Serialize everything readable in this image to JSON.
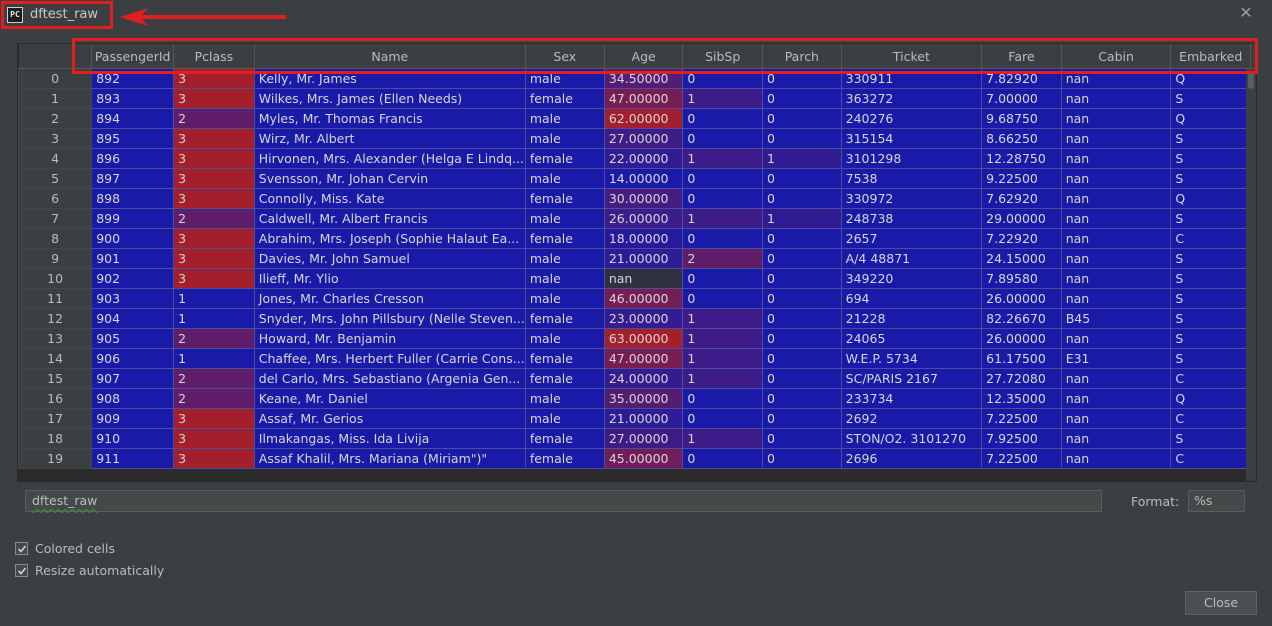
{
  "window": {
    "title": "dftest_raw",
    "icon": "pycharm-icon",
    "icon_text": "PC"
  },
  "table": {
    "columns": [
      "PassengerId",
      "Pclass",
      "Name",
      "Sex",
      "Age",
      "SibSp",
      "Parch",
      "Ticket",
      "Fare",
      "Cabin",
      "Embarked"
    ],
    "rows": [
      {
        "idx": "0",
        "cells": [
          "892",
          "3",
          "Kelly, Mr. James",
          "male",
          "34.50000",
          "0",
          "0",
          "330911",
          "7.82920",
          "nan",
          "Q"
        ]
      },
      {
        "idx": "1",
        "cells": [
          "893",
          "3",
          "Wilkes, Mrs. James (Ellen Needs)",
          "female",
          "47.00000",
          "1",
          "0",
          "363272",
          "7.00000",
          "nan",
          "S"
        ]
      },
      {
        "idx": "2",
        "cells": [
          "894",
          "2",
          "Myles, Mr. Thomas Francis",
          "male",
          "62.00000",
          "0",
          "0",
          "240276",
          "9.68750",
          "nan",
          "Q"
        ]
      },
      {
        "idx": "3",
        "cells": [
          "895",
          "3",
          "Wirz, Mr. Albert",
          "male",
          "27.00000",
          "0",
          "0",
          "315154",
          "8.66250",
          "nan",
          "S"
        ]
      },
      {
        "idx": "4",
        "cells": [
          "896",
          "3",
          "Hirvonen, Mrs. Alexander (Helga E Lindq...",
          "female",
          "22.00000",
          "1",
          "1",
          "3101298",
          "12.28750",
          "nan",
          "S"
        ]
      },
      {
        "idx": "5",
        "cells": [
          "897",
          "3",
          "Svensson, Mr. Johan Cervin",
          "male",
          "14.00000",
          "0",
          "0",
          "7538",
          "9.22500",
          "nan",
          "S"
        ]
      },
      {
        "idx": "6",
        "cells": [
          "898",
          "3",
          "Connolly, Miss. Kate",
          "female",
          "30.00000",
          "0",
          "0",
          "330972",
          "7.62920",
          "nan",
          "Q"
        ]
      },
      {
        "idx": "7",
        "cells": [
          "899",
          "2",
          "Caldwell, Mr. Albert Francis",
          "male",
          "26.00000",
          "1",
          "1",
          "248738",
          "29.00000",
          "nan",
          "S"
        ]
      },
      {
        "idx": "8",
        "cells": [
          "900",
          "3",
          "Abrahim, Mrs. Joseph (Sophie Halaut Ea...",
          "female",
          "18.00000",
          "0",
          "0",
          "2657",
          "7.22920",
          "nan",
          "C"
        ]
      },
      {
        "idx": "9",
        "cells": [
          "901",
          "3",
          "Davies, Mr. John Samuel",
          "male",
          "21.00000",
          "2",
          "0",
          "A/4 48871",
          "24.15000",
          "nan",
          "S"
        ]
      },
      {
        "idx": "10",
        "cells": [
          "902",
          "3",
          "Ilieff, Mr. Ylio",
          "male",
          "nan",
          "0",
          "0",
          "349220",
          "7.89580",
          "nan",
          "S"
        ]
      },
      {
        "idx": "11",
        "cells": [
          "903",
          "1",
          "Jones, Mr. Charles Cresson",
          "male",
          "46.00000",
          "0",
          "0",
          "694",
          "26.00000",
          "nan",
          "S"
        ]
      },
      {
        "idx": "12",
        "cells": [
          "904",
          "1",
          "Snyder, Mrs. John Pillsbury (Nelle Steven...",
          "female",
          "23.00000",
          "1",
          "0",
          "21228",
          "82.26670",
          "B45",
          "S"
        ]
      },
      {
        "idx": "13",
        "cells": [
          "905",
          "2",
          "Howard, Mr. Benjamin",
          "male",
          "63.00000",
          "1",
          "0",
          "24065",
          "26.00000",
          "nan",
          "S"
        ]
      },
      {
        "idx": "14",
        "cells": [
          "906",
          "1",
          "Chaffee, Mrs. Herbert Fuller (Carrie Cons...",
          "female",
          "47.00000",
          "1",
          "0",
          "W.E.P. 5734",
          "61.17500",
          "E31",
          "S"
        ]
      },
      {
        "idx": "15",
        "cells": [
          "907",
          "2",
          "del Carlo, Mrs. Sebastiano (Argenia Gen...",
          "female",
          "24.00000",
          "1",
          "0",
          "SC/PARIS 2167",
          "27.72080",
          "nan",
          "C"
        ]
      },
      {
        "idx": "16",
        "cells": [
          "908",
          "2",
          "Keane, Mr. Daniel",
          "male",
          "35.00000",
          "0",
          "0",
          "233734",
          "12.35000",
          "nan",
          "Q"
        ]
      },
      {
        "idx": "17",
        "cells": [
          "909",
          "3",
          "Assaf, Mr. Gerios",
          "male",
          "21.00000",
          "0",
          "0",
          "2692",
          "7.22500",
          "nan",
          "C"
        ]
      },
      {
        "idx": "18",
        "cells": [
          "910",
          "3",
          "Ilmakangas, Miss. Ida Livija",
          "female",
          "27.00000",
          "1",
          "0",
          "STON/O2. 3101270",
          "7.92500",
          "nan",
          "S"
        ]
      },
      {
        "idx": "19",
        "cells": [
          "911",
          "3",
          "Assaf Khalil, Mrs. Mariana (Miriam\")\"",
          "female",
          "45.00000",
          "0",
          "0",
          "2696",
          "7.22500",
          "nan",
          "C"
        ]
      }
    ]
  },
  "colors": {
    "cell_base": "#1a1aa8",
    "cell_hot": "#a41f2c",
    "cell_nan": "#2f3140",
    "annotation_red": "#e02020"
  },
  "name_field": {
    "value": "dftest_raw"
  },
  "format": {
    "label": "Format:",
    "value": "%s"
  },
  "options": [
    {
      "label": "Colored cells",
      "checked": true
    },
    {
      "label": "Resize automatically",
      "checked": true
    }
  ],
  "buttons": {
    "close": "Close"
  }
}
